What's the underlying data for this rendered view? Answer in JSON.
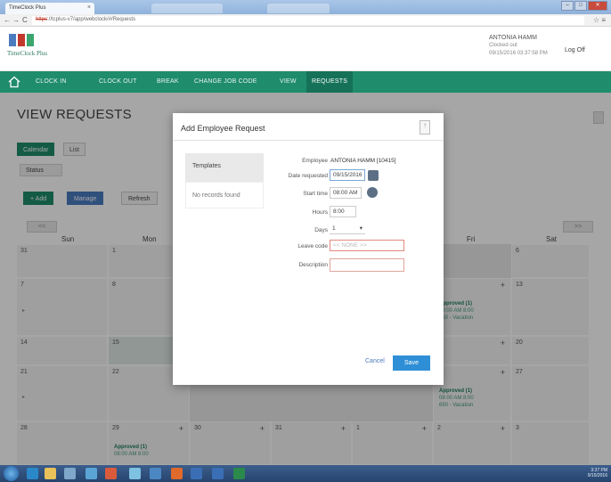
{
  "browser": {
    "tab_title": "TimeClock Plus",
    "tab_close": "×",
    "url_scheme": "https",
    "url_rest": "://tcplus-v7/app/webclock/#/Requests",
    "nav_back": "←",
    "nav_fwd": "→",
    "nav_reload": "C",
    "tools": "☆ ≡",
    "win_min": "–",
    "win_max": "□",
    "win_close": "✕"
  },
  "app": {
    "logo_text": "TimeClock Plus",
    "user_name": "ANTONIA HAMM",
    "user_status": "Clocked out",
    "user_datetime": "09/15/2016 03:37:58 PM",
    "logoff": "Log Off",
    "colors": {
      "green": "#1f8c6b",
      "blue": "#4a7bbf",
      "save": "#2f8fd6"
    }
  },
  "nav": {
    "home_icon": "home-icon",
    "items": [
      "CLOCK IN",
      "CLOCK OUT",
      "BREAK",
      "CHANGE JOB CODE",
      "VIEW",
      "REQUESTS"
    ]
  },
  "page": {
    "title": "VIEW REQUESTS",
    "tabs": [
      "Calendar",
      "List"
    ],
    "status": "Status",
    "btn_add": "+ Add",
    "btn_manage": "Manage",
    "btn_refresh": "Refresh",
    "prev": "<<",
    "next": ">>"
  },
  "calendar": {
    "days": [
      "Sun",
      "Mon",
      "Fri",
      "Sat"
    ],
    "week1": [
      "31",
      "1",
      "6"
    ],
    "week2": [
      "7",
      "8",
      "13"
    ],
    "week3": [
      "14",
      "15",
      "20"
    ],
    "week4": [
      "21",
      "22",
      "27"
    ],
    "week5": [
      "28",
      "29",
      "30",
      "31",
      "1",
      "2",
      "3"
    ],
    "approved": "Approved (1)",
    "time": "08:00 AM 8:00",
    "code": "650 - Vacation",
    "plus": "+"
  },
  "modal": {
    "title": "Add Employee Request",
    "close": "↑",
    "templates_label": "Templates",
    "templates_empty": "No records found",
    "employee_label": "Employee",
    "employee_value": "ANTONIA HAMM [10415]",
    "date_label": "Date requested",
    "date_value": "09/15/2016",
    "start_label": "Start time",
    "start_value": "08:00 AM",
    "hours_label": "Hours",
    "hours_value": "8:00",
    "days_label": "Days",
    "days_value": "1",
    "leavecode_label": "Leave code",
    "leavecode_placeholder": "<< NONE >>",
    "description_label": "Description",
    "cancel": "Cancel",
    "save": "Save"
  }
}
